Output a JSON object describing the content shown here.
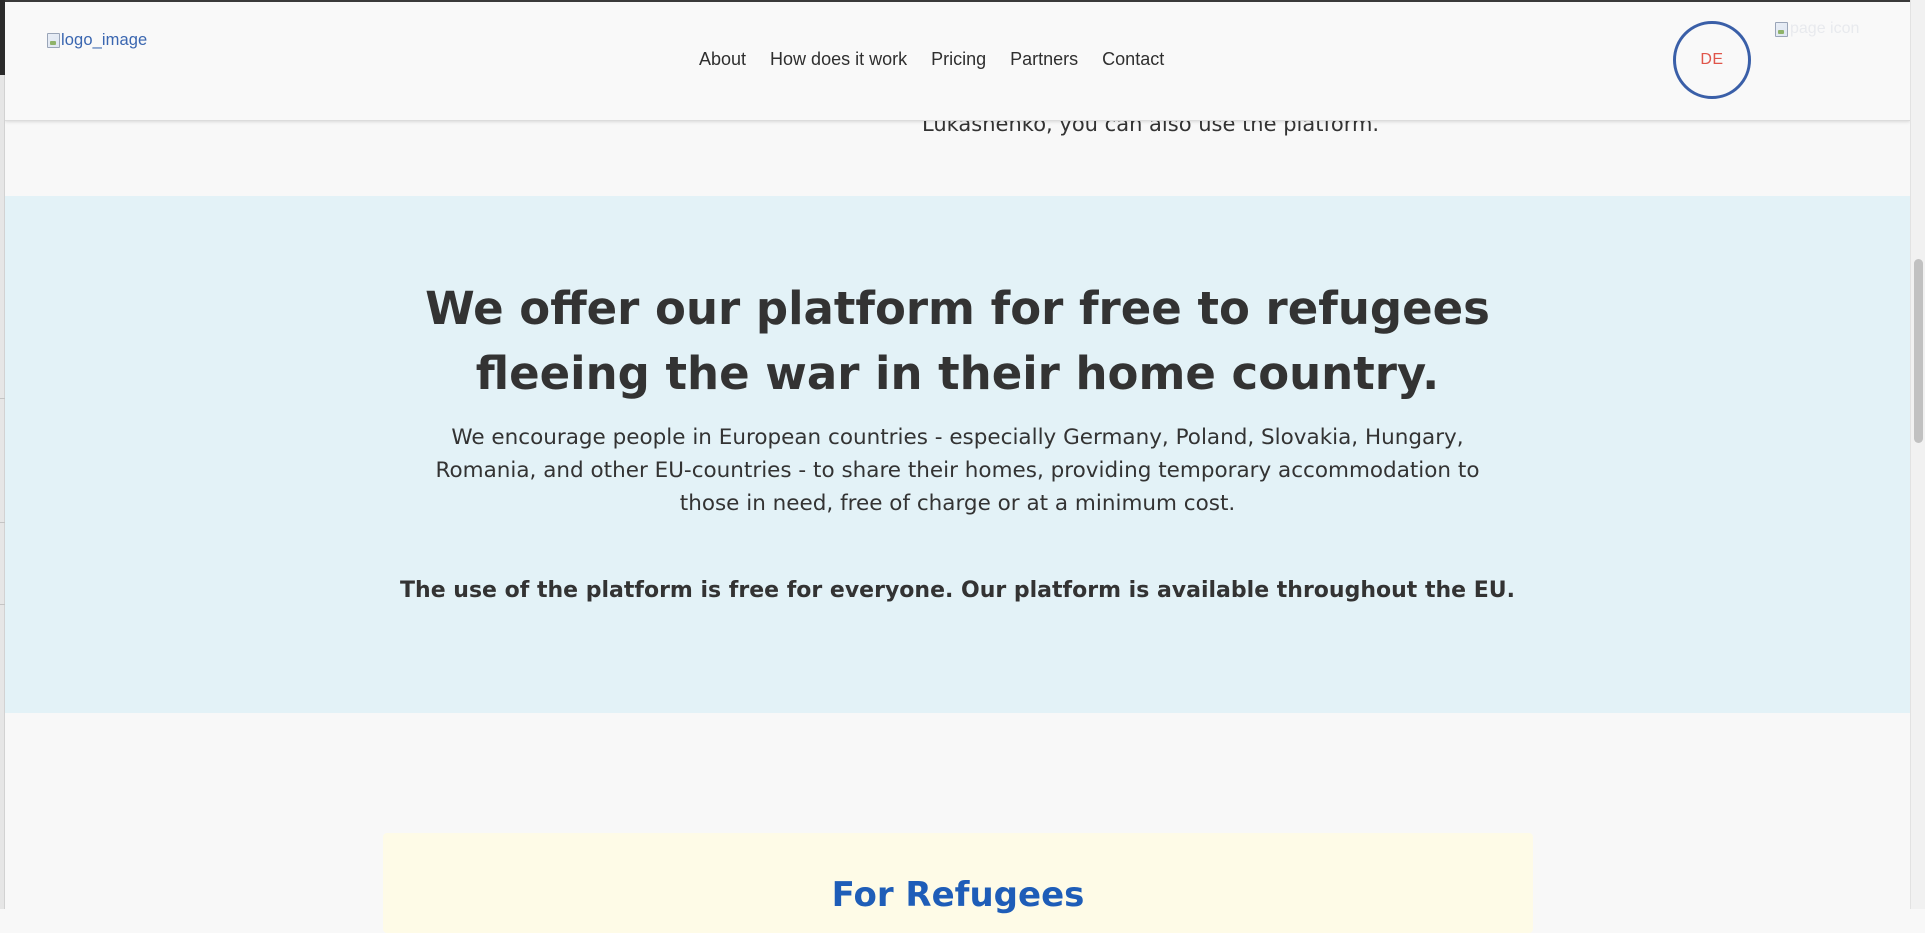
{
  "header": {
    "logo_alt": "logo_image",
    "nav": [
      {
        "label": "About"
      },
      {
        "label": "How does it work"
      },
      {
        "label": "Pricing"
      },
      {
        "label": "Partners"
      },
      {
        "label": "Contact"
      }
    ],
    "language_button": "DE",
    "corner_image_alt": "page icon"
  },
  "previous_section": {
    "text_fragment": "Lukashenko, you can also use the platform."
  },
  "free_section": {
    "title_lines": [
      "We offer our platform for free to refugees",
      "fleeing the war in their home country."
    ],
    "body_lines": [
      "We encourage people in European countries - especially Germany, Poland, Slovakia, Hungary,",
      "Romania, and other EU-countries - to share their homes, providing temporary accommodation to",
      "those in need, free of charge or at a minimum cost."
    ],
    "bold_note": "The use of the platform is free for everyone. Our platform is available throughout the EU."
  },
  "refugees_card": {
    "title": "For Refugees"
  },
  "colors": {
    "section_background": "#e3f2f7",
    "card_background": "#fefbe7",
    "accent_blue": "#1e5db8",
    "lang_border": "#3a5fa8",
    "lang_text": "#e0554a"
  }
}
